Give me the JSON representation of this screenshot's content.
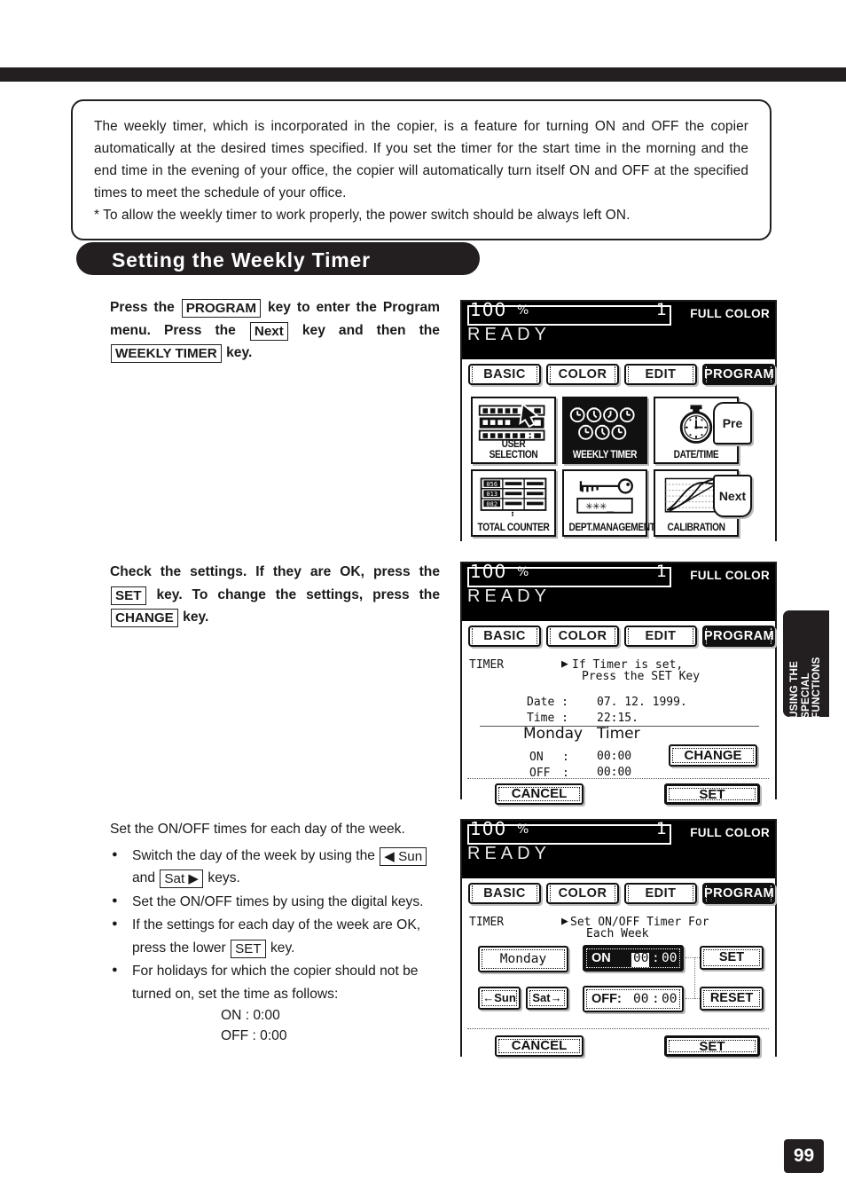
{
  "page": {
    "number": "99",
    "side_tab": "USING THE\nSPECIAL\nFUNCTIONS"
  },
  "note": {
    "line1": "The weekly timer, which is incorporated in the copier, is a feature for turning ON and OFF the copier automatically at the desired times specified.  If you set the timer for the start time in the morning and the end time in the evening of your office, the copier will automatically turn itself ON and OFF at the specified times to meet the schedule of your office.",
    "line2": "* To allow the weekly timer to work properly, the power switch should be always left ON."
  },
  "section": {
    "title": "Setting the Weekly Timer"
  },
  "step1": {
    "t1": "Press  the",
    "k1": "PROGRAM",
    "t2": "key  to  enter  the Program menu. Press the",
    "k2": "Next",
    "t3": "key and then  the",
    "k3": "WEEKLY TIMER",
    "t4": "key."
  },
  "step2": {
    "t1": "Check  the  settings.  If  they  are  OK,  press the",
    "k1": "SET",
    "t2": "key. To change the settings, press the",
    "k2": "CHANGE",
    "t3": "key."
  },
  "step3": {
    "heading": "Set the ON/OFF times for each day of the week.",
    "b1a": "Switch  the  day  of  the  week  by  using  the",
    "b1k1": "◀ Sun",
    "b1b": "and",
    "b1k2": "Sat ▶",
    "b1c": "keys.",
    "b2": "Set the ON/OFF times by using the digital keys.",
    "b3a": "If the settings for each day of the week are OK, press the lower",
    "b3k": "SET",
    "b3b": "key.",
    "b4": "For holidays for which the copier should not be turned on, set the time as follows:",
    "on_line": "ON  : 0:00",
    "off_line": "OFF : 0:00"
  },
  "lcd_common": {
    "zoom": "100",
    "percent": "%",
    "quantity": "1",
    "color_mode": "FULL COLOR",
    "status": "READY",
    "tabs": [
      {
        "label": "BASIC",
        "selected": false
      },
      {
        "label": "COLOR",
        "selected": false
      },
      {
        "label": "EDIT",
        "selected": false
      },
      {
        "label": "PROGRAM",
        "selected": true
      }
    ]
  },
  "lcd1": {
    "tiles": [
      {
        "caption": "USER SELECTION",
        "icon": "list-cursor-icon",
        "selected": false
      },
      {
        "caption": "WEEKLY TIMER",
        "icon": "seven-clocks-icon",
        "selected": true
      },
      {
        "caption": "DATE/TIME",
        "icon": "stopwatch-icon",
        "selected": false
      },
      {
        "caption": "TOTAL COUNTER",
        "icon": "counter-grid-icon",
        "selected": false
      },
      {
        "caption": "DEPT.MANAGEMENT",
        "icon": "key-password-icon",
        "selected": false
      },
      {
        "caption": "CALIBRATION",
        "icon": "curve-graph-icon",
        "selected": false
      }
    ],
    "counter_rows": [
      "056",
      "013",
      "082"
    ],
    "password_mask": "✳✳✳_",
    "prev_label": "Pre",
    "next_label": "Next"
  },
  "lcd2": {
    "title": "TIMER",
    "prompt_line1": "If Timer is set,",
    "prompt_line2": "Press the SET Key",
    "date_label": "Date :",
    "date_value": "07. 12. 1999.",
    "time_label": "Time :",
    "time_value": "22:15.",
    "day": "Monday",
    "timer_word": "Timer",
    "on_label": "ON",
    "on_colon": ":",
    "on_value": "00:00",
    "off_label": "OFF",
    "off_colon": ":",
    "off_value": "00:00",
    "change_label": "CHANGE",
    "cancel_label": "CANCEL",
    "set_label": "SET"
  },
  "lcd3": {
    "title": "TIMER",
    "prompt_line1": "Set ON/OFF Timer For",
    "prompt_line2": "Each Week",
    "day": "Monday",
    "prev_day_label": "←Sun",
    "next_day_label": "Sat→",
    "on_label": "ON",
    "on_hour": "00",
    "on_sep": ":",
    "on_min": "00",
    "off_label": "OFF:",
    "off_hour": "00",
    "off_sep": ":",
    "off_min": "00",
    "set_right_label": "SET",
    "reset_label": "RESET",
    "cancel_label": "CANCEL",
    "set_label": "SET"
  }
}
